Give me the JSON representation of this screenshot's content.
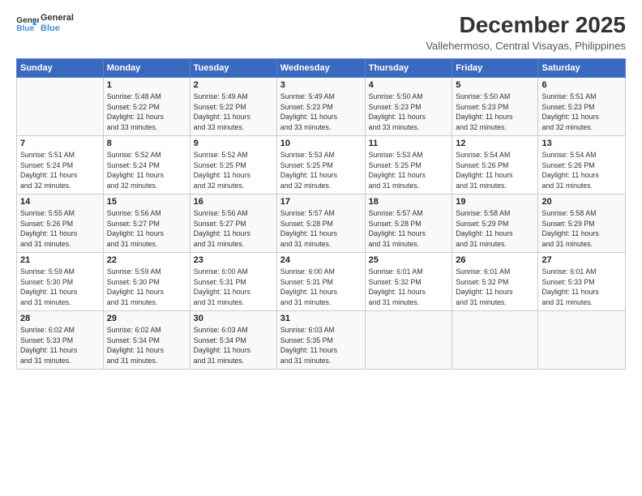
{
  "header": {
    "logo_line1": "General",
    "logo_line2": "Blue",
    "main_title": "December 2025",
    "subtitle": "Vallehermoso, Central Visayas, Philippines"
  },
  "days_of_week": [
    "Sunday",
    "Monday",
    "Tuesday",
    "Wednesday",
    "Thursday",
    "Friday",
    "Saturday"
  ],
  "weeks": [
    [
      {
        "day": "",
        "info": ""
      },
      {
        "day": "1",
        "info": "Sunrise: 5:48 AM\nSunset: 5:22 PM\nDaylight: 11 hours\nand 33 minutes."
      },
      {
        "day": "2",
        "info": "Sunrise: 5:49 AM\nSunset: 5:22 PM\nDaylight: 11 hours\nand 33 minutes."
      },
      {
        "day": "3",
        "info": "Sunrise: 5:49 AM\nSunset: 5:23 PM\nDaylight: 11 hours\nand 33 minutes."
      },
      {
        "day": "4",
        "info": "Sunrise: 5:50 AM\nSunset: 5:23 PM\nDaylight: 11 hours\nand 33 minutes."
      },
      {
        "day": "5",
        "info": "Sunrise: 5:50 AM\nSunset: 5:23 PM\nDaylight: 11 hours\nand 32 minutes."
      },
      {
        "day": "6",
        "info": "Sunrise: 5:51 AM\nSunset: 5:23 PM\nDaylight: 11 hours\nand 32 minutes."
      }
    ],
    [
      {
        "day": "7",
        "info": "Sunrise: 5:51 AM\nSunset: 5:24 PM\nDaylight: 11 hours\nand 32 minutes."
      },
      {
        "day": "8",
        "info": "Sunrise: 5:52 AM\nSunset: 5:24 PM\nDaylight: 11 hours\nand 32 minutes."
      },
      {
        "day": "9",
        "info": "Sunrise: 5:52 AM\nSunset: 5:25 PM\nDaylight: 11 hours\nand 32 minutes."
      },
      {
        "day": "10",
        "info": "Sunrise: 5:53 AM\nSunset: 5:25 PM\nDaylight: 11 hours\nand 32 minutes."
      },
      {
        "day": "11",
        "info": "Sunrise: 5:53 AM\nSunset: 5:25 PM\nDaylight: 11 hours\nand 31 minutes."
      },
      {
        "day": "12",
        "info": "Sunrise: 5:54 AM\nSunset: 5:26 PM\nDaylight: 11 hours\nand 31 minutes."
      },
      {
        "day": "13",
        "info": "Sunrise: 5:54 AM\nSunset: 5:26 PM\nDaylight: 11 hours\nand 31 minutes."
      }
    ],
    [
      {
        "day": "14",
        "info": "Sunrise: 5:55 AM\nSunset: 5:26 PM\nDaylight: 11 hours\nand 31 minutes."
      },
      {
        "day": "15",
        "info": "Sunrise: 5:56 AM\nSunset: 5:27 PM\nDaylight: 11 hours\nand 31 minutes."
      },
      {
        "day": "16",
        "info": "Sunrise: 5:56 AM\nSunset: 5:27 PM\nDaylight: 11 hours\nand 31 minutes."
      },
      {
        "day": "17",
        "info": "Sunrise: 5:57 AM\nSunset: 5:28 PM\nDaylight: 11 hours\nand 31 minutes."
      },
      {
        "day": "18",
        "info": "Sunrise: 5:57 AM\nSunset: 5:28 PM\nDaylight: 11 hours\nand 31 minutes."
      },
      {
        "day": "19",
        "info": "Sunrise: 5:58 AM\nSunset: 5:29 PM\nDaylight: 11 hours\nand 31 minutes."
      },
      {
        "day": "20",
        "info": "Sunrise: 5:58 AM\nSunset: 5:29 PM\nDaylight: 11 hours\nand 31 minutes."
      }
    ],
    [
      {
        "day": "21",
        "info": "Sunrise: 5:59 AM\nSunset: 5:30 PM\nDaylight: 11 hours\nand 31 minutes."
      },
      {
        "day": "22",
        "info": "Sunrise: 5:59 AM\nSunset: 5:30 PM\nDaylight: 11 hours\nand 31 minutes."
      },
      {
        "day": "23",
        "info": "Sunrise: 6:00 AM\nSunset: 5:31 PM\nDaylight: 11 hours\nand 31 minutes."
      },
      {
        "day": "24",
        "info": "Sunrise: 6:00 AM\nSunset: 5:31 PM\nDaylight: 11 hours\nand 31 minutes."
      },
      {
        "day": "25",
        "info": "Sunrise: 6:01 AM\nSunset: 5:32 PM\nDaylight: 11 hours\nand 31 minutes."
      },
      {
        "day": "26",
        "info": "Sunrise: 6:01 AM\nSunset: 5:32 PM\nDaylight: 11 hours\nand 31 minutes."
      },
      {
        "day": "27",
        "info": "Sunrise: 6:01 AM\nSunset: 5:33 PM\nDaylight: 11 hours\nand 31 minutes."
      }
    ],
    [
      {
        "day": "28",
        "info": "Sunrise: 6:02 AM\nSunset: 5:33 PM\nDaylight: 11 hours\nand 31 minutes."
      },
      {
        "day": "29",
        "info": "Sunrise: 6:02 AM\nSunset: 5:34 PM\nDaylight: 11 hours\nand 31 minutes."
      },
      {
        "day": "30",
        "info": "Sunrise: 6:03 AM\nSunset: 5:34 PM\nDaylight: 11 hours\nand 31 minutes."
      },
      {
        "day": "31",
        "info": "Sunrise: 6:03 AM\nSunset: 5:35 PM\nDaylight: 11 hours\nand 31 minutes."
      },
      {
        "day": "",
        "info": ""
      },
      {
        "day": "",
        "info": ""
      },
      {
        "day": "",
        "info": ""
      }
    ]
  ]
}
